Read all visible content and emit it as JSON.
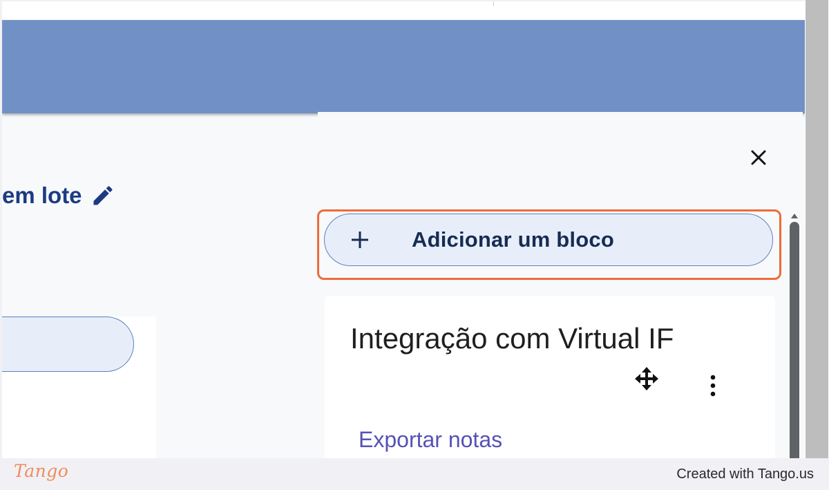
{
  "page": {
    "title_fragment": "em lote",
    "edit_icon": "pencil-icon"
  },
  "drawer": {
    "close_icon": "close-icon",
    "add_block": {
      "icon": "plus-icon",
      "label": "Adicionar um bloco"
    },
    "block": {
      "title": "Integração com Virtual IF",
      "move_icon": "move-icon",
      "menu_icon": "kebab-menu-icon",
      "link": "Exportar notas"
    }
  },
  "footer": {
    "logo": "Tango",
    "credit": "Created with Tango.us"
  },
  "colors": {
    "banner": "#7191c6",
    "title": "#1d3a83",
    "highlight": "#ee6b3b",
    "pill_border": "#5b7fc4",
    "pill_fill": "#e8eef9",
    "link": "#5552b5"
  }
}
